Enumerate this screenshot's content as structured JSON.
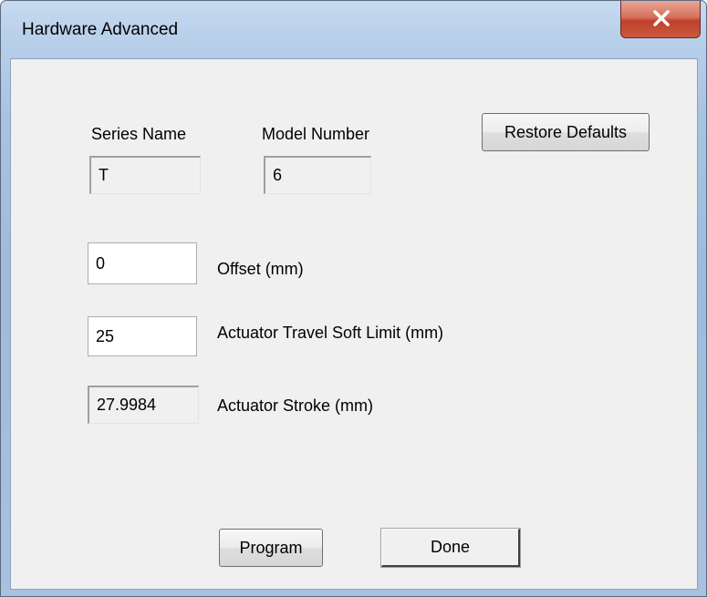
{
  "window": {
    "title": "Hardware Advanced",
    "close_icon": "close-x-icon"
  },
  "series": {
    "label": "Series Name",
    "value": "T"
  },
  "model": {
    "label": "Model Number",
    "value": "6"
  },
  "buttons": {
    "restore_defaults": "Restore Defaults",
    "program": "Program",
    "done": "Done"
  },
  "offset": {
    "value": "0",
    "label": "Offset (mm)"
  },
  "travel_limit": {
    "value": "25",
    "label": "Actuator Travel Soft Limit (mm)"
  },
  "stroke": {
    "value": "27.9984",
    "label": "Actuator Stroke (mm)"
  },
  "colors": {
    "close_button": "#c7503a",
    "frame": "#a9c3e2",
    "client_area": "#f0f0f0"
  }
}
